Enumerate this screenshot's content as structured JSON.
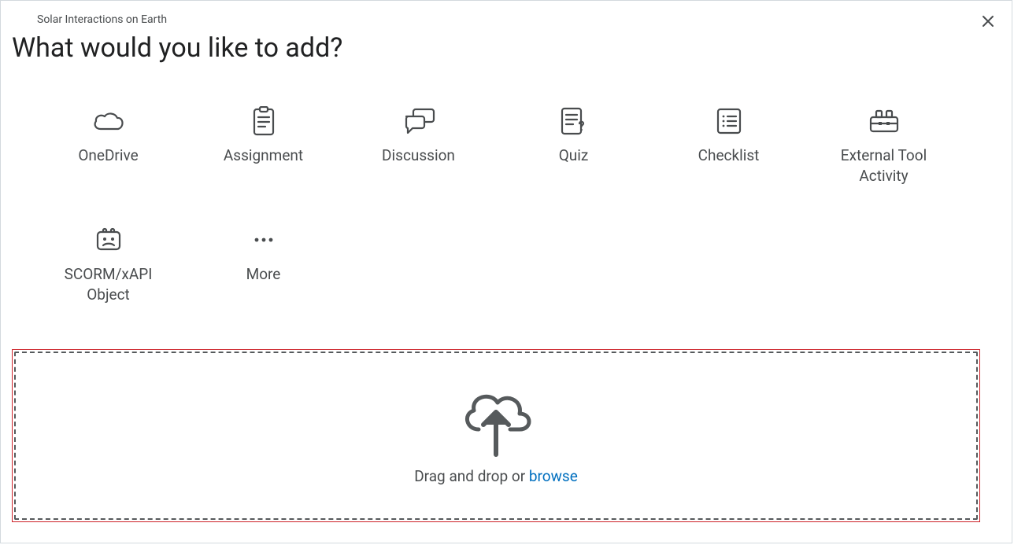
{
  "breadcrumb": "Solar Interactions on Earth",
  "title": "What would you like to add?",
  "options": [
    {
      "label": "OneDrive",
      "icon": "cloud-icon"
    },
    {
      "label": "Assignment",
      "icon": "assignment-icon"
    },
    {
      "label": "Discussion",
      "icon": "discussion-icon"
    },
    {
      "label": "Quiz",
      "icon": "quiz-icon"
    },
    {
      "label": "Checklist",
      "icon": "checklist-icon"
    },
    {
      "label": "External Tool Activity",
      "icon": "toolbox-icon"
    },
    {
      "label": "SCORM/xAPI Object",
      "icon": "scorm-icon"
    },
    {
      "label": "More",
      "icon": "more-icon"
    }
  ],
  "dropzone": {
    "prefix": "Drag and drop or ",
    "browse": "browse"
  },
  "icons": {
    "close": "close-icon",
    "upload": "cloud-upload-icon"
  },
  "colors": {
    "iconStroke": "#494c4e",
    "linkColor": "#006fbf",
    "highlightBorder": "#cd2026"
  }
}
